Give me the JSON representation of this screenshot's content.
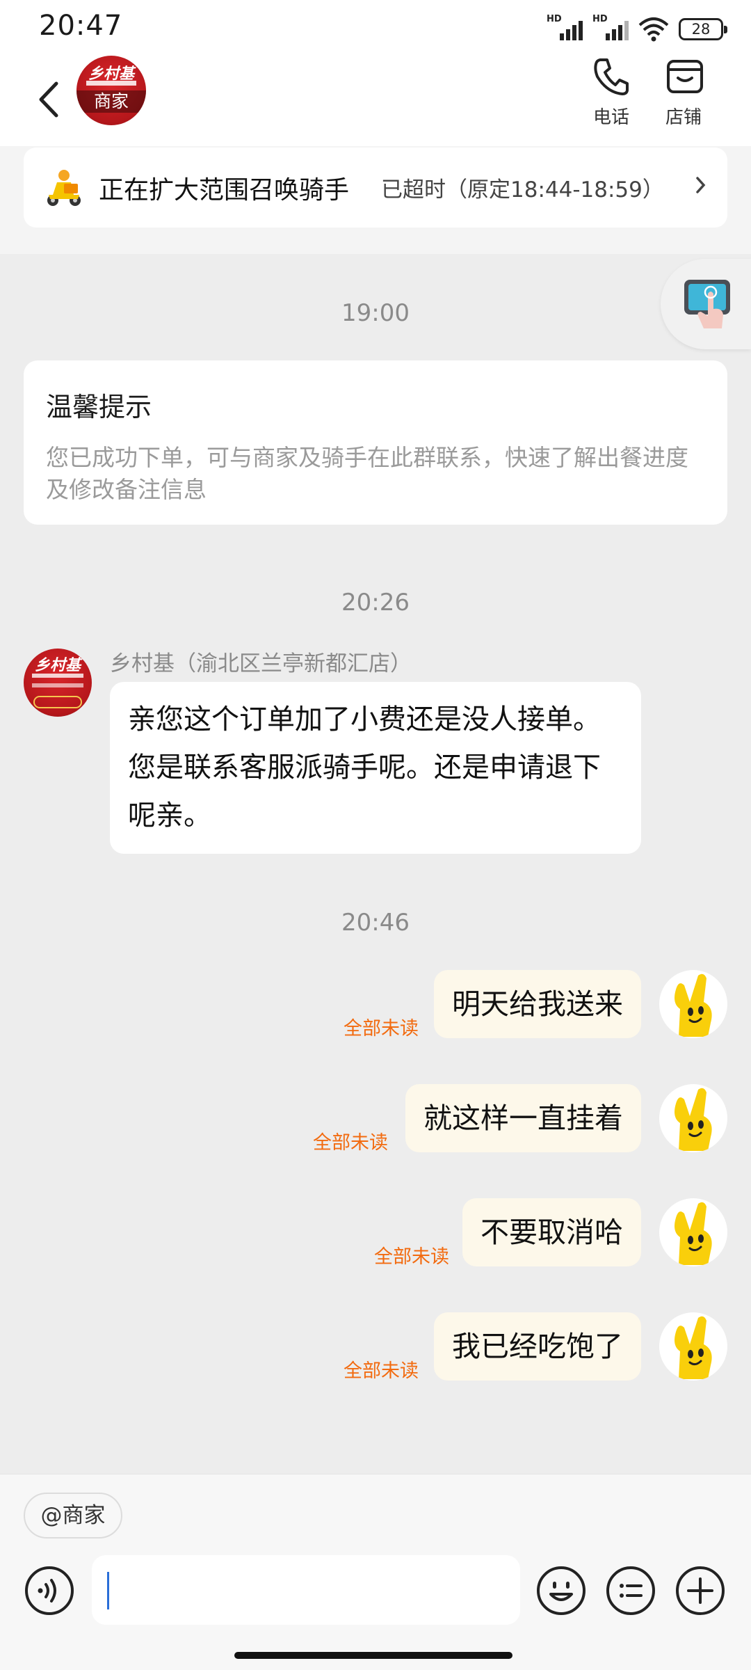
{
  "status_bar": {
    "time": "20:47",
    "battery": "28",
    "network_label": "HD"
  },
  "header": {
    "merchant_avatar": {
      "brand": "乡村基",
      "role": "商家"
    },
    "actions": [
      {
        "label": "电话",
        "icon": "phone-icon"
      },
      {
        "label": "店铺",
        "icon": "store-icon"
      }
    ]
  },
  "delivery_banner": {
    "title": "正在扩大范围召唤骑手",
    "status": "已超时（原定18:44-18:59）"
  },
  "chat": {
    "timestamps": [
      "19:00",
      "20:26",
      "20:46"
    ],
    "tip_card": {
      "title": "温馨提示",
      "body": "您已成功下单，可与商家及骑手在此群联系，快速了解出餐进度及修改备注信息"
    },
    "incoming": {
      "sender": "乡村基（渝北区兰亭新都汇店）",
      "avatar_brand": "乡村基",
      "text": "亲您这个订单加了小费还是没人接单。您是联系客服派骑手呢。还是申请退下呢亲。"
    },
    "outgoing": [
      {
        "text": "明天给我送来",
        "status": "全部未读"
      },
      {
        "text": "就这样一直挂着",
        "status": "全部未读"
      },
      {
        "text": "不要取消哈",
        "status": "全部未读"
      },
      {
        "text": "我已经吃饱了",
        "status": "全部未读"
      }
    ]
  },
  "composer": {
    "mention_chip": "@商家",
    "input_value": "",
    "tools": [
      "voice-icon",
      "emoji-icon",
      "quick-reply-icon",
      "plus-icon"
    ]
  },
  "colors": {
    "accent_orange": "#f26b10",
    "outgoing_bubble": "#fdf8ea",
    "background": "#ededed"
  }
}
